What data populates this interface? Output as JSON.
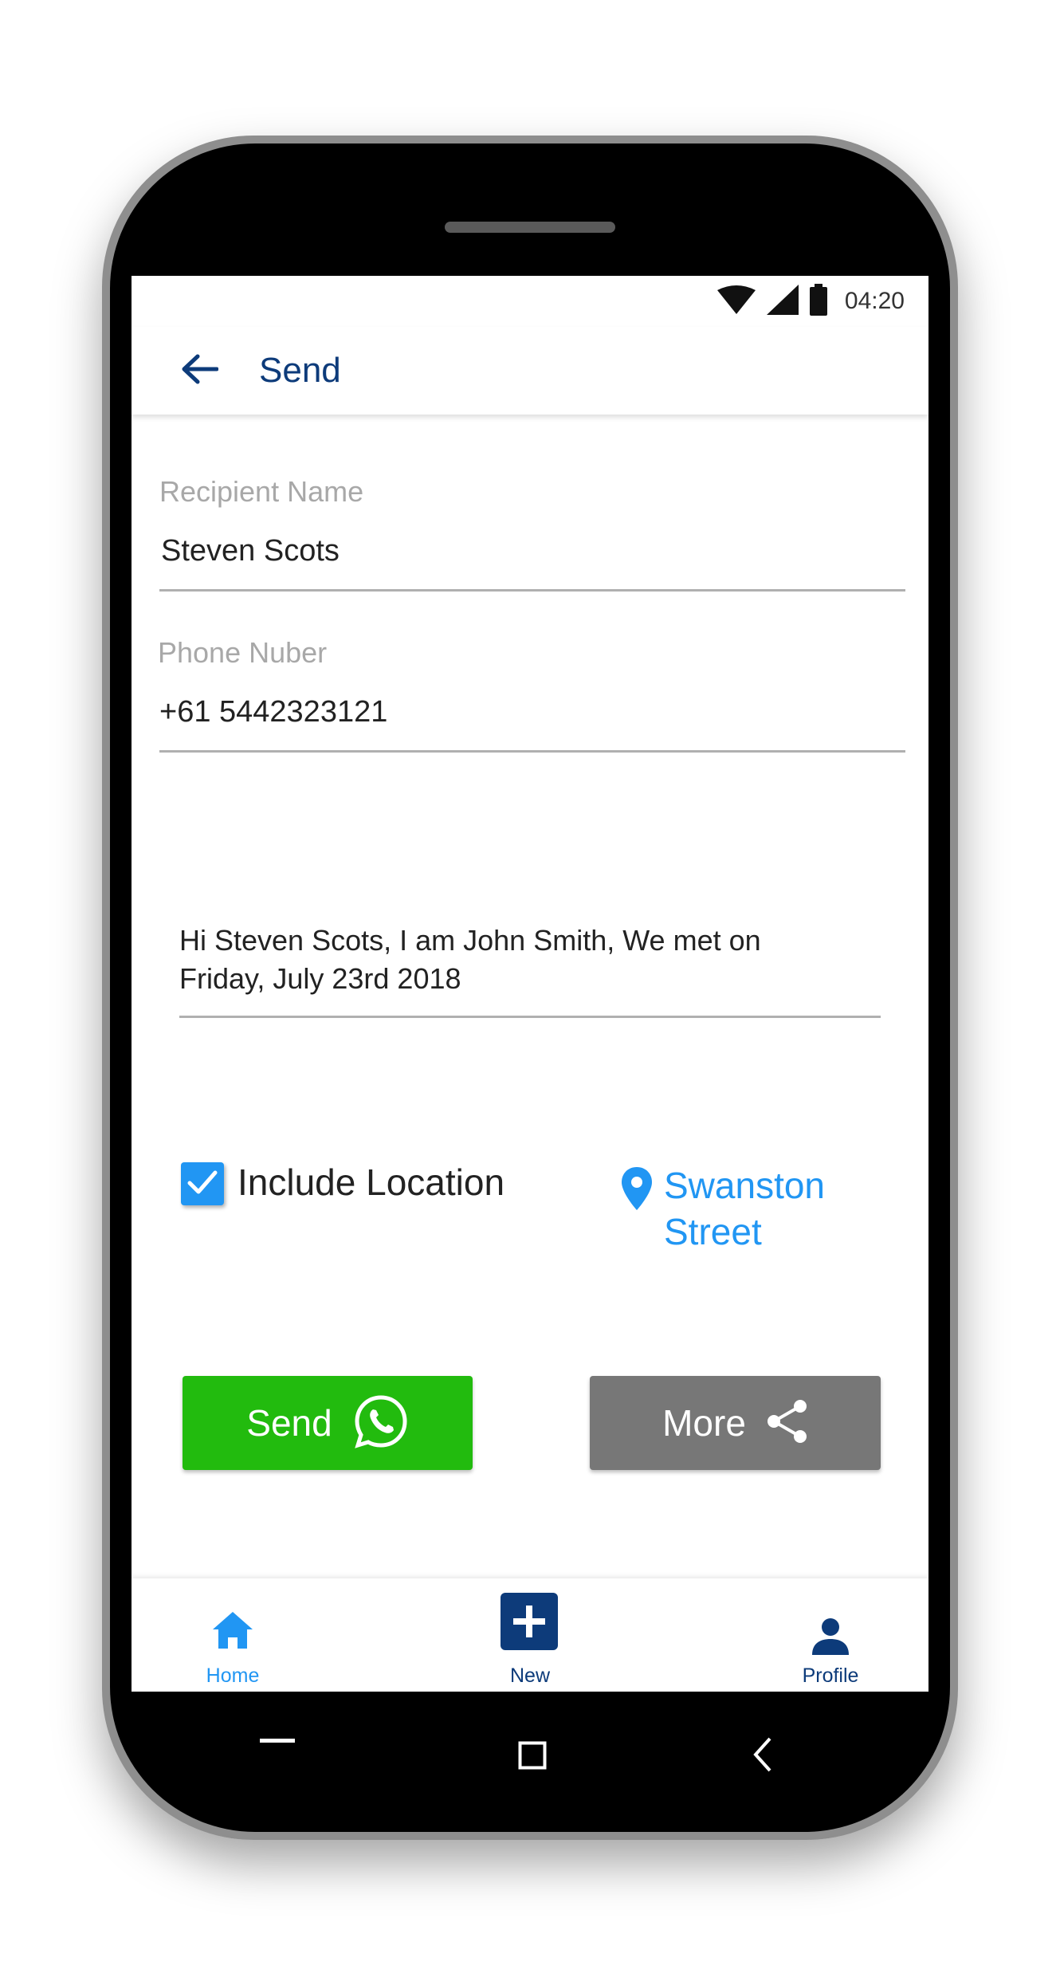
{
  "status_bar": {
    "time": "04:20",
    "icons": [
      "wifi-icon",
      "signal-icon",
      "battery-icon"
    ]
  },
  "app_bar": {
    "title": "Send",
    "back_icon": "arrow-left-icon"
  },
  "form": {
    "recipient_name": {
      "label": "Recipient Name",
      "value": "Steven Scots"
    },
    "phone_number": {
      "label": "Phone Nuber",
      "value": "+61 5442323121"
    },
    "message": {
      "value": "Hi Steven Scots, I am John Smith, We met on Friday, July 23rd 2018"
    }
  },
  "location": {
    "checkbox_label": "Include Location",
    "checked": true,
    "place": "Swanston Street",
    "pin_icon": "map-pin-icon"
  },
  "actions": {
    "send_label": "Send",
    "send_icon": "whatsapp-icon",
    "more_label": "More",
    "more_icon": "share-icon"
  },
  "bottom_nav": {
    "items": [
      {
        "label": "Home",
        "icon": "home-icon",
        "active": true
      },
      {
        "label": "New",
        "icon": "plus-square-icon",
        "active": false
      },
      {
        "label": "Profile",
        "icon": "person-icon",
        "active": false
      }
    ]
  },
  "colors": {
    "primary_dark": "#0d3b7a",
    "accent_blue": "#2196f3",
    "whatsapp_green": "#22bb0e",
    "more_gray": "#777777"
  }
}
